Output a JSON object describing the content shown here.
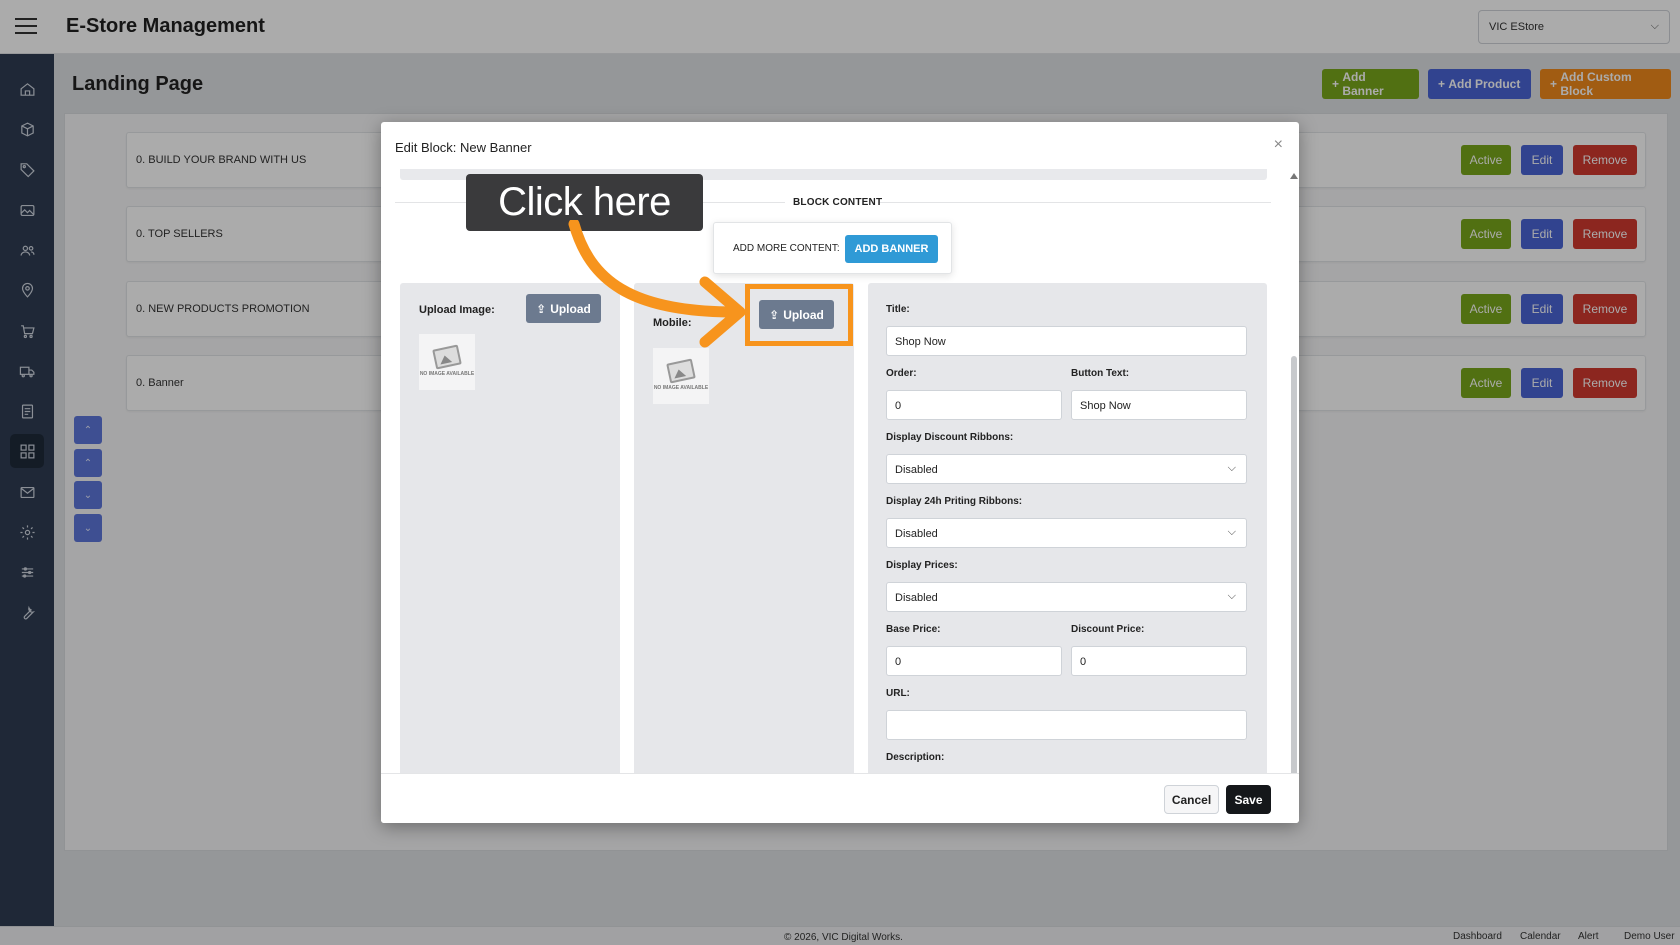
{
  "app": {
    "title": "E-Store Management",
    "store_select": "VIC EStore"
  },
  "page": {
    "title": "Landing Page"
  },
  "header_buttons": {
    "add_banner": "Add Banner",
    "add_product": "Add Product",
    "add_custom_block": "Add Custom Block"
  },
  "blocks": [
    {
      "title": "0. BUILD YOUR BRAND WITH US",
      "active": "Active",
      "edit": "Edit",
      "remove": "Remove"
    },
    {
      "title": "0. TOP SELLERS",
      "active": "Active",
      "edit": "Edit",
      "remove": "Remove"
    },
    {
      "title": "0. NEW PRODUCTS PROMOTION",
      "active": "Active",
      "edit": "Edit",
      "remove": "Remove"
    },
    {
      "title": "0. Banner",
      "active": "Active",
      "edit": "Edit",
      "remove": "Remove"
    }
  ],
  "sidebar_icons": [
    "home-icon",
    "box-icon",
    "tag-icon",
    "image-icon",
    "users-icon",
    "location-icon",
    "cart-icon",
    "truck-icon",
    "document-icon",
    "layout-icon",
    "mail-icon",
    "gear-icon",
    "sliders-icon",
    "wrench-icon"
  ],
  "modal": {
    "title": "Edit Block: New Banner",
    "close": "×",
    "block_content": "BLOCK CONTENT",
    "add_more_label": "ADD MORE CONTENT:",
    "add_banner": "ADD BANNER",
    "upload_image_label": "Upload Image:",
    "upload_mobile_label": "Mobile:",
    "upload": "Upload",
    "no_image_text": "NO IMAGE AVAILABLE",
    "fields": {
      "title_label": "Title:",
      "title_value": "Shop Now",
      "order_label": "Order:",
      "order_value": "0",
      "button_text_label": "Button Text:",
      "button_text_value": "Shop Now",
      "discount_ribbons_label": "Display Discount Ribbons:",
      "discount_ribbons_value": "Disabled",
      "printing_ribbons_label": "Display 24h Priting Ribbons:",
      "printing_ribbons_value": "Disabled",
      "display_prices_label": "Display Prices:",
      "display_prices_value": "Disabled",
      "base_price_label": "Base Price:",
      "base_price_value": "0",
      "discount_price_label": "Discount Price:",
      "discount_price_value": "0",
      "url_label": "URL:",
      "url_value": "",
      "description_label": "Description:"
    },
    "cancel": "Cancel",
    "save": "Save"
  },
  "tutorial": {
    "callout": "Click here",
    "accent_color": "#f7941d"
  },
  "footer": {
    "copyright": "© 2026, VIC Digital Works.",
    "links": [
      "Dashboard",
      "Calendar",
      "Alert",
      "Demo User"
    ]
  }
}
